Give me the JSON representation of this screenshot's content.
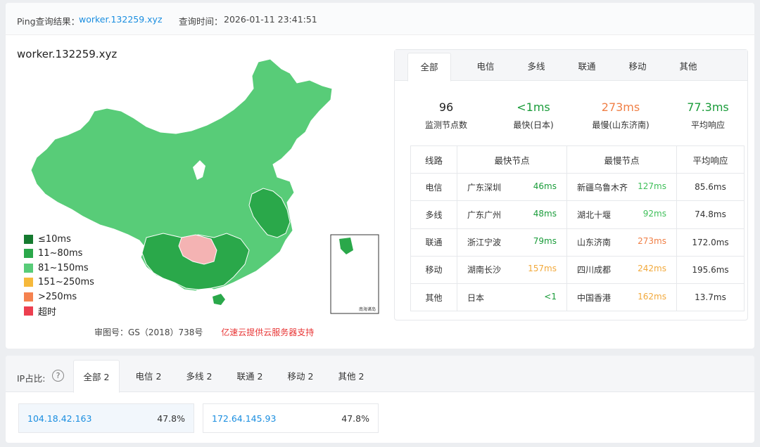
{
  "header": {
    "ping_label": "Ping查询结果：",
    "domain": "worker.132259.xyz",
    "time_label": "查询时间：",
    "time": "2026-01-11 23:41:51"
  },
  "map": {
    "title": "worker.132259.xyz",
    "legend": [
      {
        "label": "≤10ms",
        "color": "#157a2f"
      },
      {
        "label": "11~80ms",
        "color": "#2aa84a"
      },
      {
        "label": "81~150ms",
        "color": "#58cc78"
      },
      {
        "label": "151~250ms",
        "color": "#f6b93b"
      },
      {
        "label": ">250ms",
        "color": "#f5824f"
      },
      {
        "label": "超时",
        "color": "#ec3f4f"
      }
    ],
    "approval": "审图号：GS（2018）738号",
    "support": "亿速云提供云服务器支持",
    "inset_label": "南海诸岛"
  },
  "tabs": [
    "全部",
    "电信",
    "多线",
    "联通",
    "移动",
    "其他"
  ],
  "summary": [
    {
      "value": "96",
      "label": "监测节点数",
      "color": "#222222"
    },
    {
      "value": "<1ms",
      "label": "最快(日本)",
      "color": "#1a9c3a"
    },
    {
      "value": "273ms",
      "label": "最慢(山东济南)",
      "color": "#f08047"
    },
    {
      "value": "77.3ms",
      "label": "平均响应",
      "color": "#1a9c3a"
    }
  ],
  "table": {
    "headers": [
      "线路",
      "最快节点",
      "最慢节点",
      "平均响应"
    ],
    "rows": [
      {
        "route": "电信",
        "fast_node": "广东深圳",
        "fast_ms": "46ms",
        "slow_node": "新疆乌鲁木齐",
        "slow_ms": "127ms",
        "avg": "85.6ms"
      },
      {
        "route": "多线",
        "fast_node": "广东广州",
        "fast_ms": "48ms",
        "slow_node": "湖北十堰",
        "slow_ms": "92ms",
        "avg": "74.8ms"
      },
      {
        "route": "联通",
        "fast_node": "浙江宁波",
        "fast_ms": "79ms",
        "slow_node": "山东济南",
        "slow_ms": "273ms",
        "avg": "172.0ms"
      },
      {
        "route": "移动",
        "fast_node": "湖南长沙",
        "fast_ms": "157ms",
        "slow_node": "四川成都",
        "slow_ms": "242ms",
        "avg": "195.6ms"
      },
      {
        "route": "其他",
        "fast_node": "日本",
        "fast_ms": "<1",
        "slow_node": "中国香港",
        "slow_ms": "162ms",
        "avg": "13.7ms"
      }
    ]
  },
  "ip": {
    "label": "IP占比:",
    "help_icon": "?",
    "tabs": [
      "全部 2",
      "电信 2",
      "多线 2",
      "联通 2",
      "移动 2",
      "其他 2"
    ],
    "entries": [
      {
        "ip": "104.18.42.163",
        "pct": "47.8%"
      },
      {
        "ip": "172.64.145.93",
        "pct": "47.8%"
      }
    ]
  }
}
